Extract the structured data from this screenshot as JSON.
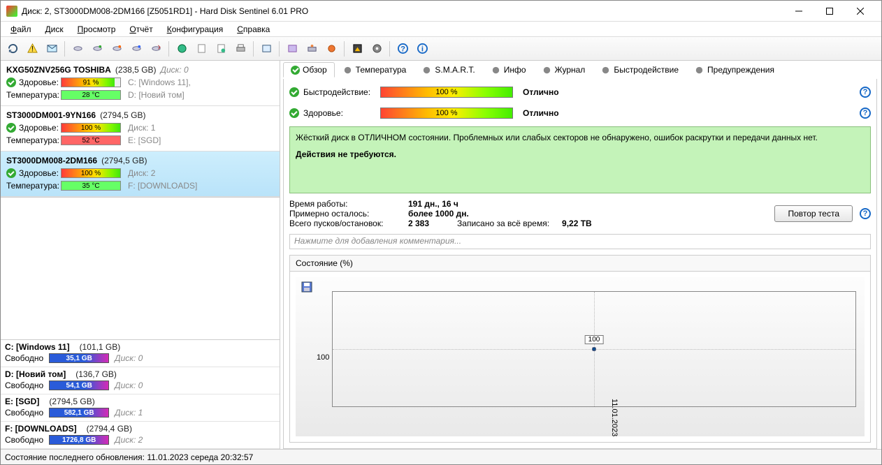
{
  "window": {
    "title": "Диск: 2, ST3000DM008-2DM166 [Z5051RD1]  -  Hard Disk Sentinel 6.01 PRO"
  },
  "menu": [
    "Файл",
    "Диск",
    "Просмотр",
    "Отчёт",
    "Конфигурация",
    "Справка"
  ],
  "sidebar": {
    "disks": [
      {
        "name": "KXG50ZNV256G TOSHIBA",
        "size": "(238,5 GB)",
        "disk_no": "Диск: 0",
        "health_label": "Здоровье:",
        "health": "91 %",
        "temp_label": "Температура:",
        "temp": "28 °C",
        "drv1": "C: [Windows 11],",
        "drv2": "D: [Новий том]",
        "temp_warn": false,
        "selected": false
      },
      {
        "name": "ST3000DM001-9YN166",
        "size": "(2794,5 GB)",
        "disk_no": "",
        "health_label": "Здоровье:",
        "health": "100 %",
        "temp_label": "Температура:",
        "temp": "52 °C",
        "drv1": "Диск: 1",
        "drv2": "E: [SGD]",
        "temp_warn": true,
        "selected": false
      },
      {
        "name": "ST3000DM008-2DM166",
        "size": "(2794,5 GB)",
        "disk_no": "",
        "health_label": "Здоровье:",
        "health": "100 %",
        "temp_label": "Температура:",
        "temp": "35 °C",
        "drv1": "Диск: 2",
        "drv2": "F: [DOWNLOADS]",
        "temp_warn": false,
        "selected": true
      }
    ],
    "partitions": [
      {
        "name": "C: [Windows 11]",
        "size": "(101,1 GB)",
        "free_label": "Свободно",
        "free": "35,1 GB",
        "disk": "Диск: 0"
      },
      {
        "name": "D: [Новий том]",
        "size": "(136,7 GB)",
        "free_label": "Свободно",
        "free": "54,1 GB",
        "disk": "Диск: 0"
      },
      {
        "name": "E: [SGD]",
        "size": "(2794,5 GB)",
        "free_label": "Свободно",
        "free": "582,1 GB",
        "disk": "Диск: 1"
      },
      {
        "name": "F: [DOWNLOADS]",
        "size": "(2794,4 GB)",
        "free_label": "Свободно",
        "free": "1726,8 GB",
        "disk": "Диск: 2"
      }
    ]
  },
  "tabs": {
    "items": [
      "Обзор",
      "Температура",
      "S.M.A.R.T.",
      "Инфо",
      "Журнал",
      "Быстродействие",
      "Предупреждения"
    ],
    "active": 0
  },
  "metrics": {
    "perf_label": "Быстродействие:",
    "perf_val": "100 %",
    "perf_txt": "Отлично",
    "health_label": "Здоровье:",
    "health_val": "100 %",
    "health_txt": "Отлично"
  },
  "statusbox": {
    "line1": "Жёсткий диск в ОТЛИЧНОМ состоянии. Проблемных или слабых секторов не обнаружено, ошибок раскрутки и передачи данных нет.",
    "line2": "Действия не требуются."
  },
  "kv": {
    "runtime_k": "Время работы:",
    "runtime_v": "191 дн., 16 ч",
    "remain_k": "Примерно осталось:",
    "remain_v": "более 1000 дн.",
    "starts_k": "Всего пусков/остановок:",
    "starts_v": "2 383",
    "written_k": "Записано за всё время:",
    "written_v": "9,22 ТВ",
    "retest": "Повтор теста"
  },
  "comment_placeholder": "Нажмите для добавления комментария...",
  "chart": {
    "title": "Состояние (%)",
    "ylabel": "100",
    "xlabel": "11.01.2023",
    "point_label": "100"
  },
  "chart_data": {
    "type": "line",
    "x": [
      "11.01.2023"
    ],
    "values": [
      100
    ],
    "ylabel": "Состояние (%)",
    "ylim": [
      0,
      100
    ]
  },
  "statusbar": "Состояние последнего обновления: 11.01.2023 середа 20:32:57"
}
